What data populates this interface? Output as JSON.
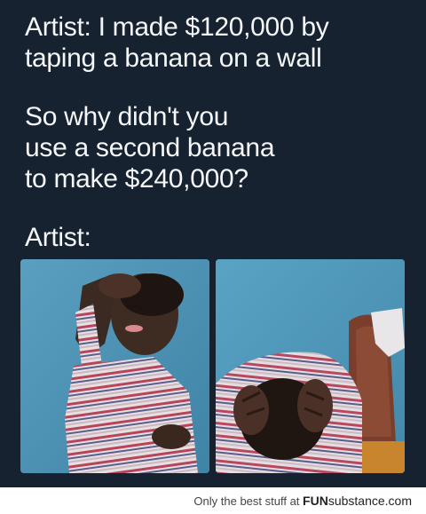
{
  "meme": {
    "setup_lines": [
      "Artist: I made $120,000 by",
      "taping a banana on a wall"
    ],
    "question_lines": [
      "So why didn't you",
      "use a second banana",
      "to make $240,000?"
    ],
    "reaction_label": "Artist:"
  },
  "images": {
    "left": "crying-child-photo",
    "right": "child-holding-head-photo"
  },
  "footer": {
    "tagline": "Only the best stuff at",
    "brand_fun": "FUN",
    "brand_sub": "substance",
    "brand_tail": ".com"
  },
  "colors": {
    "background": "#162230",
    "text": "#f4f6f8",
    "photo_wall": "#4f93b5",
    "footer_bg": "#ffffff"
  }
}
